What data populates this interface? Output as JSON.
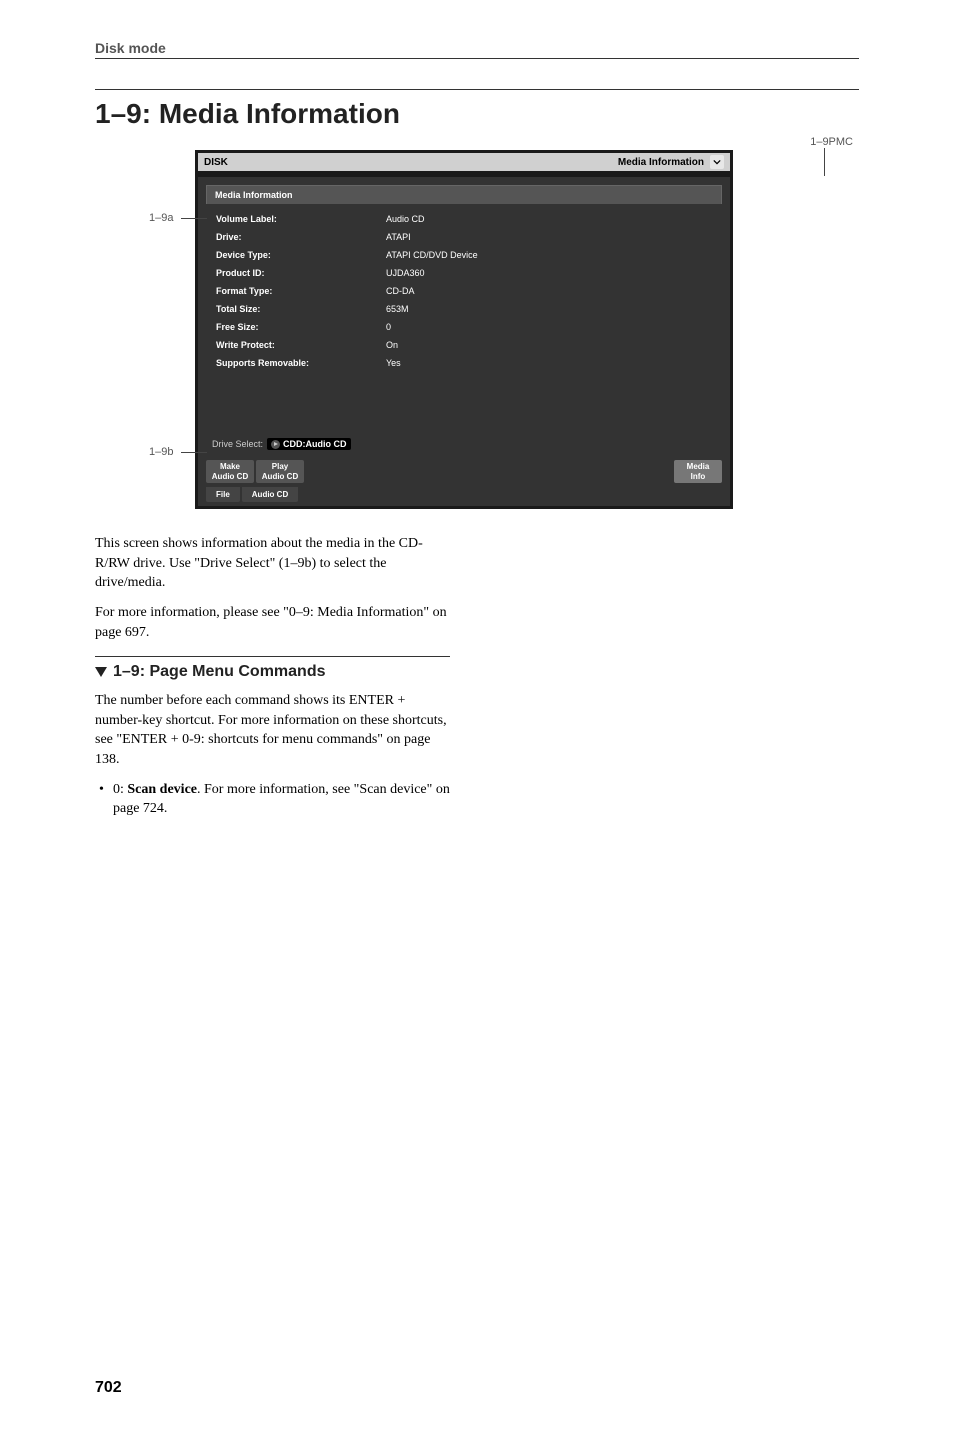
{
  "header": {
    "mode": "Disk mode"
  },
  "section": {
    "title": "1–9: Media Information"
  },
  "callouts": {
    "top": "1–9PMC",
    "left_a": "1–9a",
    "left_b": "1–9b"
  },
  "screen": {
    "top_left": "DISK",
    "top_right": "Media Information",
    "tab": "Media Information",
    "rows": [
      {
        "label": "Volume Label:",
        "value": "Audio CD"
      },
      {
        "label": "Drive:",
        "value": "ATAPI"
      },
      {
        "label": "Device Type:",
        "value": "ATAPI CD/DVD Device"
      },
      {
        "label": "Product ID:",
        "value": "UJDA360"
      },
      {
        "label": "Format Type:",
        "value": "CD-DA"
      },
      {
        "label": "Total Size:",
        "value": "653M"
      },
      {
        "label": "Free Size:",
        "value": "0"
      },
      {
        "label": "Write Protect:",
        "value": "On"
      },
      {
        "label": "Supports Removable:",
        "value": "Yes"
      }
    ],
    "drive_select_label": "Drive Select:",
    "drive_select_value": "CDD:Audio CD",
    "tabs_bottom": {
      "make": "Make\nAudio CD",
      "play": "Play\nAudio CD",
      "media": "Media\nInfo"
    },
    "tabs_lower": {
      "file": "File",
      "audio": "Audio CD"
    }
  },
  "body": {
    "p1": "This screen shows information about the media in the CD-R/RW drive. Use \"Drive Select\" (1–9b) to select the drive/media.",
    "p2": "For more information, please see \"0–9: Media Information\" on page 697."
  },
  "subsection": {
    "title": "1–9: Page Menu Commands",
    "p1": "The number before each command shows its ENTER + number-key shortcut. For more information on these shortcuts, see \"ENTER + 0-9: shortcuts for menu commands\" on page 138.",
    "bullet_prefix": "0: ",
    "bullet_bold": "Scan device",
    "bullet_rest": ". For more information, see \"Scan device\" on page 724."
  },
  "page_number": "702"
}
